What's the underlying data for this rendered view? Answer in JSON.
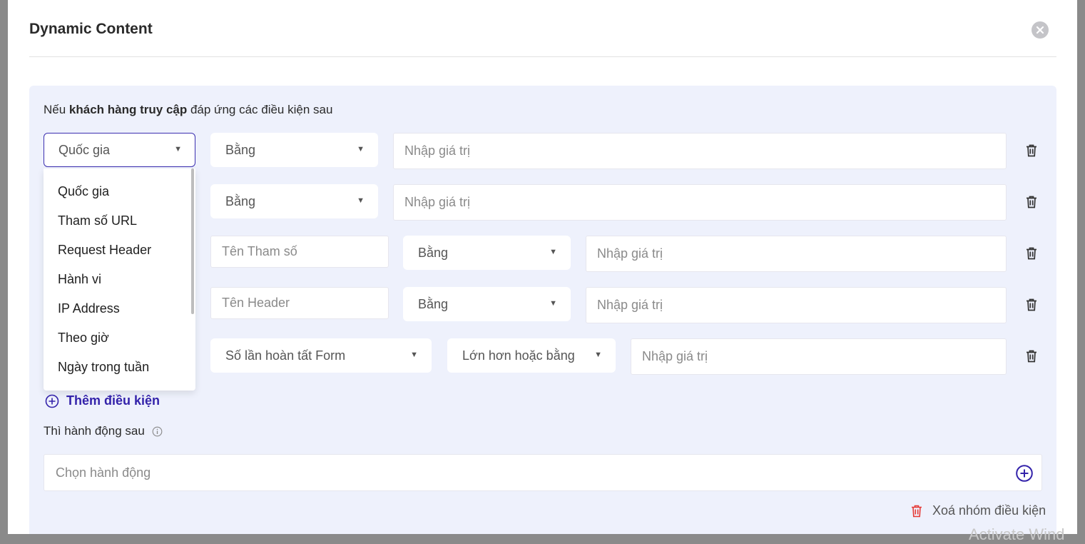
{
  "modal": {
    "title": "Dynamic Content",
    "close_icon": "close-icon"
  },
  "group": {
    "intro_prefix": "Nếu ",
    "intro_bold": "khách hàng truy cập",
    "intro_suffix": " đáp ứng các điều kiện sau",
    "rows": [
      {
        "type": "Quốc gia",
        "operator": "Bằng",
        "value_placeholder": "Nhập giá trị"
      },
      {
        "operator": "Bằng",
        "value_placeholder": "Nhập giá trị"
      },
      {
        "param_placeholder": "Tên Tham số",
        "operator": "Bằng",
        "value_placeholder": "Nhập giá trị"
      },
      {
        "param_placeholder": "Tên Header",
        "operator": "Bằng",
        "value_placeholder": "Nhập giá trị"
      },
      {
        "sub_type": "Số lần hoàn tất Form",
        "operator": "Lớn hơn hoặc bằng",
        "value_placeholder": "Nhập giá trị"
      }
    ],
    "dropdown_options": [
      "Quốc gia",
      "Tham số URL",
      "Request Header",
      "Hành vi",
      "IP Address",
      "Theo giờ",
      "Ngày trong tuần"
    ],
    "add_condition_label": "Thêm điều kiện",
    "then_label": "Thì hành động sau",
    "action_placeholder": "Chọn hành động",
    "delete_group_label": "Xoá nhóm điều kiện"
  },
  "watermark": "Activate Wind",
  "colors": {
    "accent": "#3b2fb0",
    "group_bg": "#eef1fc",
    "delete_red": "#e53935"
  }
}
